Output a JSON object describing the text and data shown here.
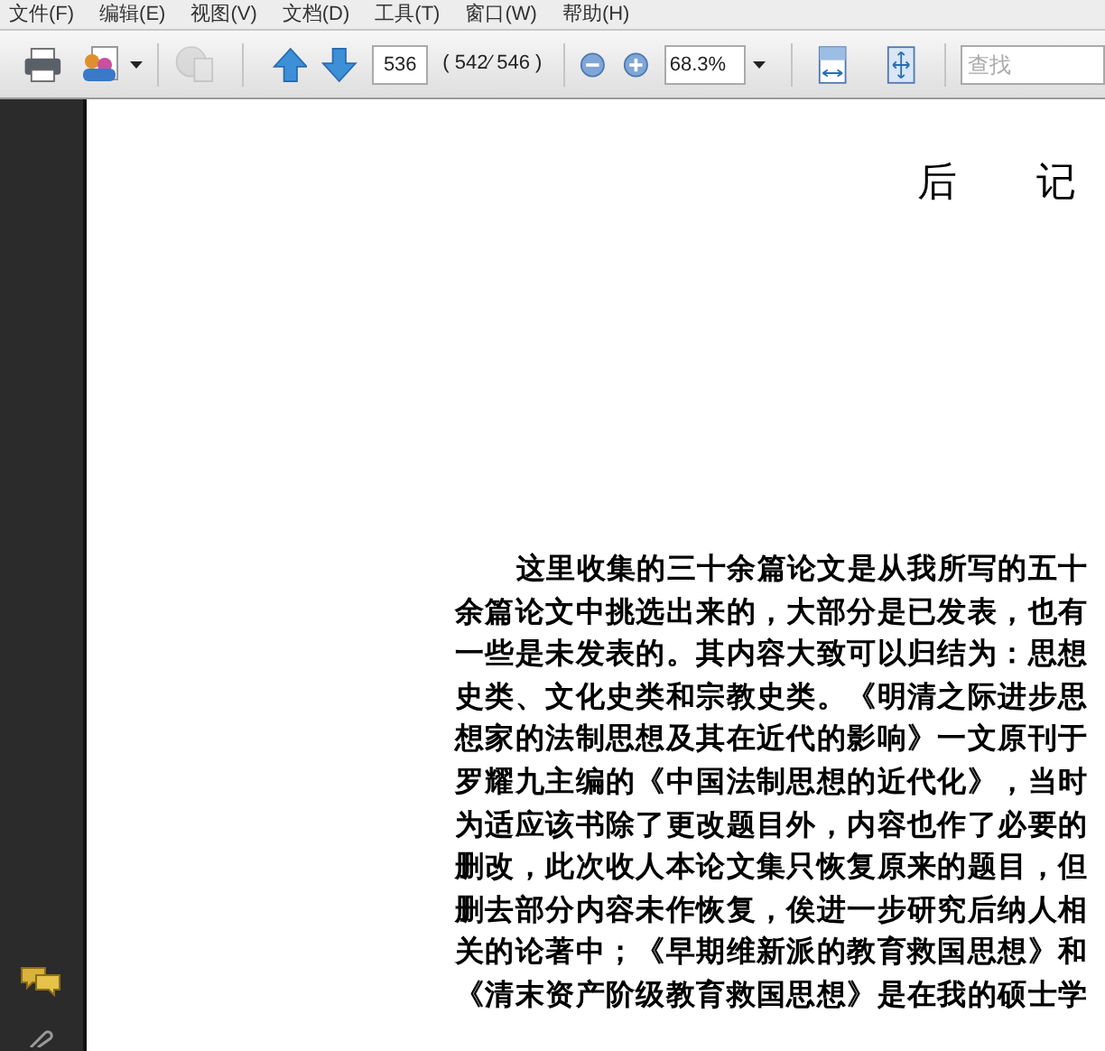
{
  "menu": [
    "文件(F)",
    "编辑(E)",
    "视图(V)",
    "文档(D)",
    "工具(T)",
    "窗口(W)",
    "帮助(H)"
  ],
  "toolbar": {
    "page_number": "536",
    "page_count": "( 542⁄ 546 )",
    "zoom": "68.3%",
    "search": {
      "placeholder": "查找"
    }
  },
  "page": {
    "title": "后 记",
    "lines": [
      "这里收集的三十余篇论文是从我所写的五十",
      "余篇论文中挑选出来的，大部分是已发表，也有",
      "一些是未发表的。其内容大致可以归结为：思想",
      "史类、文化史类和宗教史类。《明清之际进步思",
      "想家的法制思想及其在近代的影响》一文原刊于",
      "罗耀九主编的《中国法制思想的近代化》，当时",
      "为适应该书除了更改题目外，内容也作了必要的",
      "删改，此次收人本论文集只恢复原来的题目，但",
      "删去部分内容未作恢复，俟进一步研究后纳人相",
      "关的论著中；《早期维新派的教育救国思想》和",
      "《清末资产阶级教育救国思想》是在我的硕士学"
    ]
  }
}
